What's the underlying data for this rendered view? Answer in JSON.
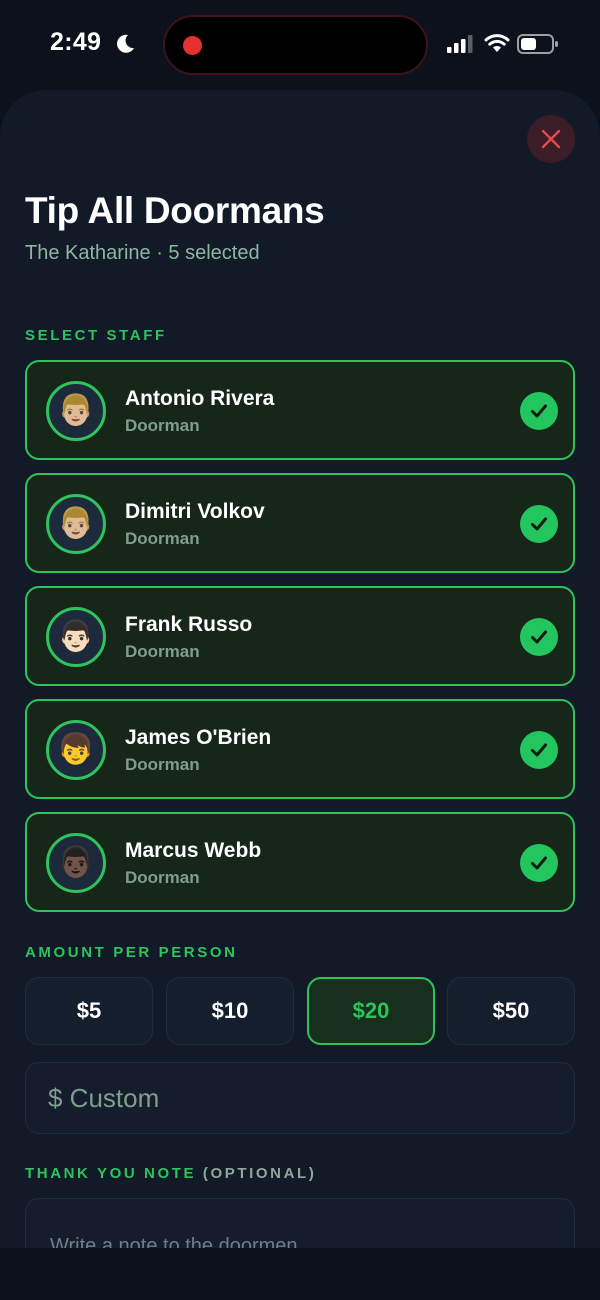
{
  "status_bar": {
    "time": "2:49"
  },
  "sheet": {
    "title": "Tip All Doormans",
    "subtitle": "The Katharine · 5 selected"
  },
  "staff_section": {
    "label": "SELECT STAFF",
    "staff": [
      {
        "name": "Antonio Rivera",
        "role": "Doorman",
        "avatar": "👨🏼",
        "selected": true
      },
      {
        "name": "Dimitri Volkov",
        "role": "Doorman",
        "avatar": "👨🏼",
        "selected": true
      },
      {
        "name": "Frank Russo",
        "role": "Doorman",
        "avatar": "👨🏻",
        "selected": true
      },
      {
        "name": "James O'Brien",
        "role": "Doorman",
        "avatar": "👦",
        "selected": true
      },
      {
        "name": "Marcus Webb",
        "role": "Doorman",
        "avatar": "👨🏿",
        "selected": true
      }
    ]
  },
  "amount_section": {
    "label": "AMOUNT PER PERSON",
    "options": [
      {
        "label": "$5",
        "selected": false
      },
      {
        "label": "$10",
        "selected": false
      },
      {
        "label": "$20",
        "selected": true
      },
      {
        "label": "$50",
        "selected": false
      }
    ],
    "custom_placeholder": "$ Custom"
  },
  "note_section": {
    "label": "THANK YOU NOTE",
    "optional": "(OPTIONAL)",
    "placeholder": "Write a note to the doormen..."
  },
  "colors": {
    "accent": "#2fc25d",
    "background": "#0c111b",
    "sheet": "#111a26",
    "close_red": "#e5484d"
  },
  "icons": {
    "close": "close-icon",
    "check": "checkmark-icon",
    "moon": "moon-icon",
    "signal": "cellular-signal-icon",
    "wifi": "wifi-icon",
    "battery": "battery-icon"
  }
}
